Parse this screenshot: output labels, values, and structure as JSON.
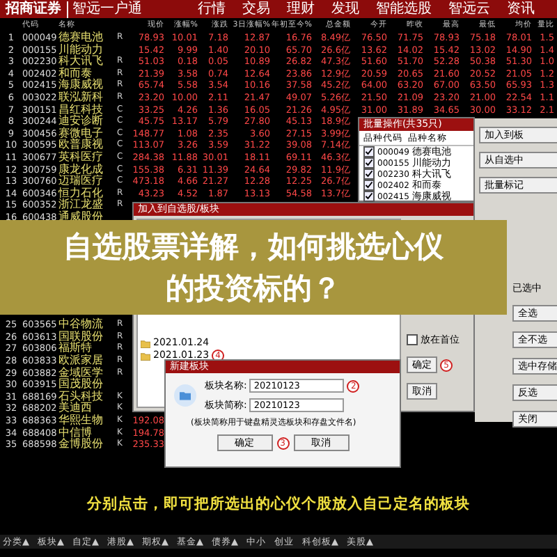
{
  "app_bar": {
    "logo": "招商证券",
    "product": "智远一户通",
    "menu": [
      "行情",
      "交易",
      "理财",
      "发现",
      "智能选股",
      "智远云",
      "资讯"
    ]
  },
  "table": {
    "columns": [
      "代码",
      "名称",
      "现价",
      "涨幅%",
      "涨跌",
      "3日涨幅%",
      "年初至今%",
      "总金额",
      "今开",
      "昨收",
      "最高",
      "最低",
      "均价",
      "量比"
    ],
    "rows_above_banner": [
      {
        "no": "1",
        "code": "000049",
        "name": "德赛电池",
        "flag": "R",
        "cells": [
          "78.93",
          "10.01",
          "7.18",
          "12.87",
          "16.76",
          "8.49亿",
          "76.50",
          "71.75",
          "78.93",
          "75.18",
          "78.01",
          "1.5"
        ]
      },
      {
        "no": "2",
        "code": "000155",
        "name": "川能动力",
        "cells": [
          "15.42",
          "9.99",
          "1.40",
          "20.10",
          "65.70",
          "26.6亿",
          "13.62",
          "14.02",
          "15.42",
          "13.02",
          "14.90",
          "1.4"
        ]
      },
      {
        "no": "3",
        "code": "002230",
        "name": "科大讯飞",
        "flag": "R",
        "cells": [
          "51.03",
          "0.18",
          "0.05",
          "10.89",
          "26.82",
          "47.3亿",
          "51.60",
          "51.70",
          "52.28",
          "50.38",
          "51.30",
          "1.0"
        ]
      },
      {
        "no": "4",
        "code": "002402",
        "name": "和而泰",
        "flag": "R",
        "cells": [
          "21.39",
          "3.58",
          "0.74",
          "12.64",
          "23.86",
          "12.9亿",
          "20.59",
          "20.65",
          "21.60",
          "20.52",
          "21.05",
          "1.2"
        ]
      },
      {
        "no": "5",
        "code": "002415",
        "name": "海康威视",
        "flag": "R",
        "cells": [
          "65.74",
          "5.58",
          "3.54",
          "10.16",
          "37.58",
          "45.2亿",
          "64.00",
          "63.20",
          "67.00",
          "63.50",
          "65.93",
          "1.3"
        ]
      },
      {
        "no": "6",
        "code": "003022",
        "name": "联泓新科",
        "flag": "R",
        "cells": [
          "23.20",
          "10.00",
          "2.11",
          "21.47",
          "49.07",
          "5.26亿",
          "21.50",
          "21.09",
          "23.20",
          "21.00",
          "22.54",
          "1.1"
        ]
      },
      {
        "no": "7",
        "code": "300151",
        "name": "昌红科技",
        "flag": "C",
        "cells": [
          "33.25",
          "4.26",
          "1.36",
          "16.05",
          "21.26",
          "4.95亿",
          "31.00",
          "31.89",
          "34.65",
          "30.00",
          "33.12",
          "2.1"
        ]
      },
      {
        "no": "8",
        "code": "300244",
        "name": "迪安诊断",
        "flag": "C",
        "cells": [
          "45.75",
          "13.17",
          "5.79",
          "27.80",
          "45.13",
          "18.9亿"
        ]
      },
      {
        "no": "9",
        "code": "300456",
        "name": "赛微电子",
        "flag": "C",
        "cells": [
          "148.77",
          "1.08",
          "2.35",
          "3.60",
          "27.15",
          "3.99亿"
        ]
      },
      {
        "no": "10",
        "code": "300595",
        "name": "欧普康视",
        "flag": "C",
        "cells": [
          "113.07",
          "3.26",
          "3.59",
          "31.22",
          "39.08",
          "7.14亿"
        ]
      },
      {
        "no": "11",
        "code": "300677",
        "name": "英科医疗",
        "flag": "C",
        "cells": [
          "284.38",
          "11.88",
          "30.01",
          "18.11",
          "69.11",
          "46.3亿"
        ]
      },
      {
        "no": "12",
        "code": "300759",
        "name": "康龙化成",
        "flag": "C",
        "cells": [
          "155.38",
          "6.31",
          "11.39",
          "24.64",
          "29.82",
          "11.9亿"
        ]
      },
      {
        "no": "13",
        "code": "300760",
        "name": "迈瑞医疗",
        "flag": "C",
        "cells": [
          "473.18",
          "4.66",
          "21.27",
          "12.28",
          "12.25",
          "26.7亿"
        ]
      },
      {
        "no": "14",
        "code": "600346",
        "name": "恒力石化",
        "flag": "R",
        "cells": [
          "43.23",
          "4.52",
          "1.87",
          "13.13",
          "54.58",
          "13.7亿"
        ]
      },
      {
        "no": "15",
        "code": "600352",
        "name": "浙江龙盛",
        "flag": "R"
      },
      {
        "no": "16",
        "code": "600438",
        "name": "通威股份"
      }
    ],
    "rows_below_banner": [
      {
        "no": "25",
        "code": "603565",
        "name": "中谷物流",
        "flag": "R"
      },
      {
        "no": "26",
        "code": "603613",
        "name": "国联股份",
        "flag": "R"
      },
      {
        "no": "27",
        "code": "603806",
        "name": "福斯特",
        "flag": "R"
      },
      {
        "no": "28",
        "code": "603833",
        "name": "欧派家居",
        "flag": "R"
      },
      {
        "no": "29",
        "code": "603882",
        "name": "金域医学",
        "flag": "R"
      },
      {
        "no": "30",
        "code": "603915",
        "name": "国茂股份"
      },
      {
        "no": "31",
        "code": "688169",
        "name": "石头科技",
        "flag": "K"
      },
      {
        "no": "32",
        "code": "688202",
        "name": "美迪西",
        "flag": "K"
      },
      {
        "no": "33",
        "code": "688363",
        "name": "华熙生物",
        "flag": "K",
        "cells": [
          "192.08"
        ]
      },
      {
        "no": "34",
        "code": "688408",
        "name": "中信博",
        "flag": "K",
        "cells": [
          "194.78"
        ]
      },
      {
        "no": "35",
        "code": "688598",
        "name": "金博股份",
        "flag": "K",
        "cells": [
          "235.33"
        ]
      }
    ]
  },
  "stock_dialog": {
    "title": "批量操作(共35只)",
    "columns": [
      "品种代码",
      "品种名称"
    ],
    "items": [
      {
        "code": "000049",
        "name": "德赛电池",
        "checked": true
      },
      {
        "code": "000155",
        "name": "川能动力",
        "checked": true
      },
      {
        "code": "002230",
        "name": "科大讯飞",
        "checked": true
      },
      {
        "code": "002402",
        "name": "和而泰",
        "checked": true
      },
      {
        "code": "002415",
        "name": "海康威视",
        "checked": true
      }
    ]
  },
  "side_buttons": [
    "加入到板",
    "从自选中",
    "批量标记"
  ],
  "board_dialog": {
    "title": "加入到自选股/板块",
    "boards": [
      {
        "label": "2021.01.24"
      },
      {
        "label": "2021.01.23",
        "step": "4"
      }
    ],
    "first_option": {
      "label": "放在首位",
      "checked": false
    },
    "ok": {
      "label": "确定",
      "step": "5"
    },
    "cancel": "取消"
  },
  "select_panel": {
    "status": "已选中",
    "buttons": [
      "全选",
      "全不选",
      "选中存储",
      "反选",
      "关闭"
    ]
  },
  "new_board_dialog": {
    "title": "新建板块",
    "name_label": "板块名称:",
    "name_value": "20210123",
    "name_step": "2",
    "short_label": "板块简称:",
    "short_value": "20210123",
    "note": "(板块简称用于键盘精灵选板块和存盘文件名)",
    "ok": {
      "label": "确定",
      "step": "3"
    },
    "cancel": "取消"
  },
  "banner": {
    "lines": [
      "自选股票详解，如何挑选心仪",
      "的投资标的？"
    ]
  },
  "caption": "分别点击，即可把所选出的心仪个股放入自己定名的板块",
  "bottom_tabs": [
    "分类▲",
    "板块▲",
    "自定▲",
    "港股▲",
    "期权▲",
    "基金▲",
    "债券▲",
    "中小",
    "创业",
    "科创板▲",
    "美股▲"
  ]
}
